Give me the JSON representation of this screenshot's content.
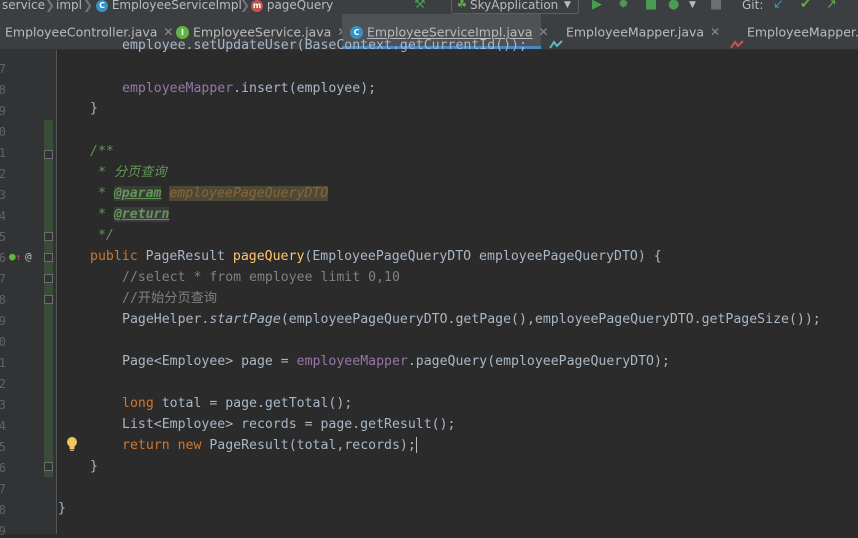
{
  "breadcrumb": {
    "items": [
      "service",
      "impl",
      "EmployeeServiceImpl",
      "pageQuery"
    ]
  },
  "toolbar": {
    "run_config": "SkyApplication",
    "git_label": "Git:"
  },
  "tabs": [
    {
      "label": "EmployeeController.java",
      "icon": "class-icon"
    },
    {
      "label": "EmployeeService.java",
      "icon": "interface-icon"
    },
    {
      "label": "EmployeeServiceImpl.java",
      "icon": "class-icon",
      "active": true
    },
    {
      "label": "EmployeeMapper.java",
      "icon": "mapper-icon"
    },
    {
      "label": "EmployeeMapper.",
      "icon": "mapper-icon"
    }
  ],
  "gutter": {
    "line_numbers": [
      "",
      "7",
      "8",
      "9",
      "0",
      "1",
      "2",
      "3",
      "4",
      "5",
      "6",
      "7",
      "8",
      "9",
      "0",
      "1",
      "2",
      "3",
      "4",
      "5",
      "6",
      "7",
      "8",
      "9",
      "0",
      "1"
    ]
  },
  "code": {
    "l1": "employee.setUpdateUser(BaseContext.getCurrentId());",
    "l2_field": "employeeMapper",
    "l2_rest": ".insert(employee);",
    "l3": "}",
    "l5": "/**",
    "l6": " * 分页查询",
    "l7_pre": " * ",
    "l7_tag": "@param",
    "l7_arg": "employeePageQueryDTO",
    "l8_pre": " * ",
    "l8_tag": "@return",
    "l9": " */",
    "l10_kw": "public",
    "l10_type": " PageResult ",
    "l10_fn": "pageQuery",
    "l10_rest": "(EmployeePageQueryDTO employeePageQueryDTO) {",
    "l11": "//select * from employee limit 0,10",
    "l12": "//开始分页查询",
    "l13_a": "PageHelper.",
    "l13_b": "startPage",
    "l13_c": "(employeePageQueryDTO.getPage(),employeePageQueryDTO.getPageSize());",
    "l15_a": "Page<Employee> page = ",
    "l15_b": "employeeMapper",
    "l15_c": ".pageQuery(employeePageQueryDTO);",
    "l17_kw": "long",
    "l17_rest": " total = page.getTotal();",
    "l18": "List<Employee> records = page.getResult();",
    "l19_kw1": "return",
    "l19_kw2": " new",
    "l19_rest": " PageResult(total,records);",
    "l20": "}",
    "l22": "}"
  },
  "colors": {
    "background": "#2b2b2b",
    "keyword": "#cc7832",
    "field": "#9876aa",
    "comment": "#808080",
    "doc": "#629755",
    "function": "#ffc66d",
    "text": "#a9b7c6",
    "active_tab_underline": "#4a88c7"
  }
}
